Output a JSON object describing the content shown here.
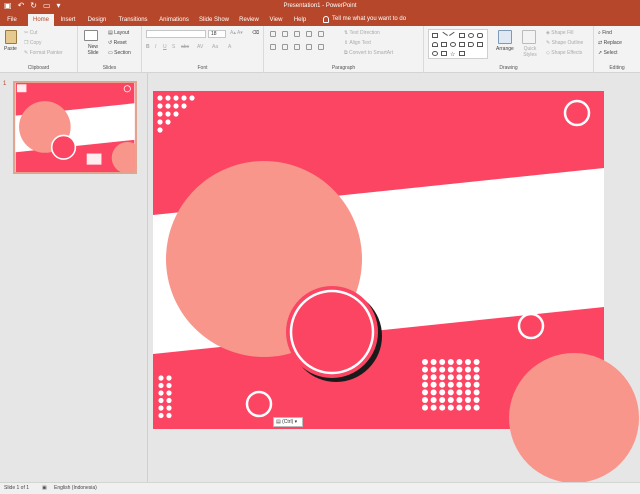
{
  "window": {
    "title": "Presentation1 - PowerPoint"
  },
  "qat": {
    "save_icon": "save-icon",
    "undo_icon": "undo-icon",
    "redo_icon": "redo-icon",
    "start_icon": "present-icon"
  },
  "tabs": [
    {
      "label": "File"
    },
    {
      "label": "Home"
    },
    {
      "label": "Insert"
    },
    {
      "label": "Design"
    },
    {
      "label": "Transitions"
    },
    {
      "label": "Animations"
    },
    {
      "label": "Slide Show"
    },
    {
      "label": "Review"
    },
    {
      "label": "View"
    },
    {
      "label": "Help"
    }
  ],
  "tellme": "Tell me what you want to do",
  "ribbon": {
    "clipboard": {
      "label": "Clipboard",
      "paste": "Paste",
      "cut": "Cut",
      "copy": "Copy",
      "format_painter": "Format Painter"
    },
    "slides": {
      "label": "Slides",
      "new_slide": "New Slide",
      "layout": "Layout",
      "reset": "Reset",
      "section": "Section"
    },
    "font": {
      "label": "Font",
      "font_name": "",
      "font_size": "18"
    },
    "paragraph": {
      "label": "Paragraph",
      "text_direction": "Text Direction",
      "align_text": "Align Text",
      "smartart": "Convert to SmartArt"
    },
    "drawing": {
      "label": "Drawing",
      "arrange": "Arrange",
      "quick_styles": "Quick Styles",
      "shape_fill": "Shape Fill",
      "shape_outline": "Shape Outline",
      "shape_effects": "Shape Effects"
    },
    "editing": {
      "label": "Editing",
      "find": "Find",
      "replace": "Replace",
      "select": "Select"
    }
  },
  "thumbnail": {
    "number": "1"
  },
  "paste_options": "(Ctrl)",
  "status": {
    "slide": "Slide 1 of 1",
    "language": "English (Indonesia)"
  },
  "colors": {
    "accent": "#b7472a",
    "coral": "#fc4563",
    "salmon": "#f8968b",
    "white": "#ffffff"
  }
}
